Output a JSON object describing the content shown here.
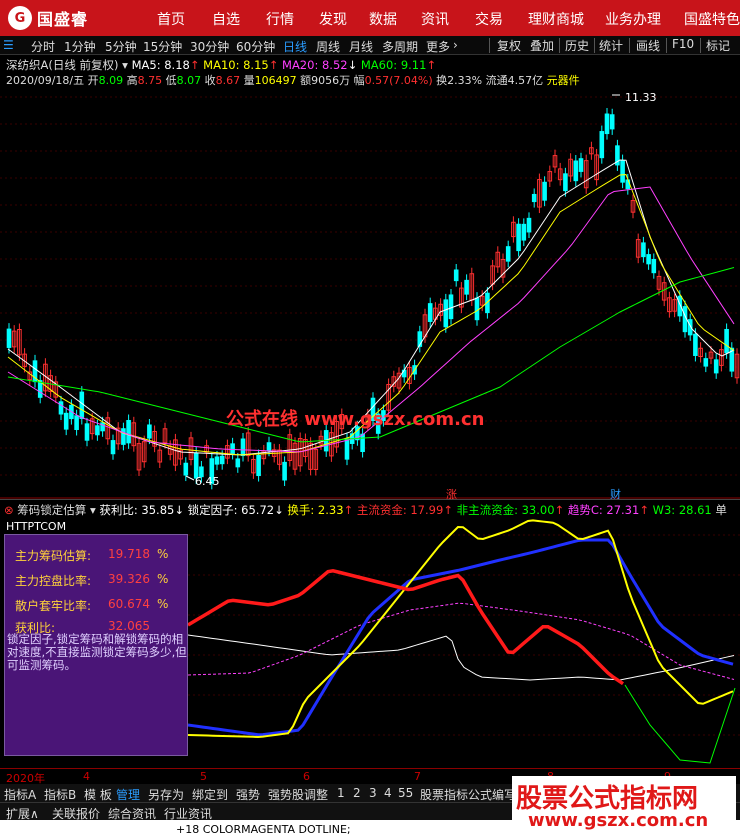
{
  "app": {
    "logo_text": "国盛睿",
    "nav": [
      "首页",
      "自选",
      "行情",
      "发现",
      "数据",
      "资讯",
      "交易",
      "理财商城",
      "业务办理",
      "国盛特色"
    ]
  },
  "periods": {
    "items": [
      "分时",
      "1分钟",
      "5分钟",
      "15分钟",
      "30分钟",
      "60分钟",
      "日线",
      "周线",
      "月线",
      "多周期",
      "更多"
    ],
    "active": "日线",
    "more_arrow": "›",
    "right_buttons": [
      "复权",
      "叠加",
      "历史",
      "统计",
      "画线",
      "F10",
      "标记"
    ]
  },
  "stock": {
    "name": "深纺织A",
    "mode": "(日线 前复权)",
    "ma": [
      {
        "label": "MA5: 8.18",
        "color": "#ffffff"
      },
      {
        "label": "MA10: 8.15",
        "color": "#ffff00"
      },
      {
        "label": "MA20: 8.52",
        "color": "#ff40ff"
      },
      {
        "label": "MA60: 9.11",
        "color": "#00ff00"
      }
    ],
    "ma_arrows": [
      "↑",
      "↑",
      "↓",
      "↑"
    ],
    "date": "2020/09/18/五",
    "open_label": "开",
    "open": "8.09",
    "high_label": "高",
    "high": "8.75",
    "low_label": "低",
    "low": "8.07",
    "close_label": "收",
    "close": "8.67",
    "vol_label": "量",
    "vol": "106497",
    "amt_label": "额",
    "amt": "9056万",
    "chg_label": "幅",
    "chg": "0.57(7.04%)",
    "turn_label": "换",
    "turn": "2.33%",
    "float_label": "流通",
    "float": "4.57亿",
    "sector": "元器件"
  },
  "main_chart_labels": {
    "high_mark": "11.33",
    "low_mark": "6.45",
    "watermark": "公式在线 www.gszx.com.cn"
  },
  "indicator": {
    "name": "筹码锁定估算",
    "arrow": "▾",
    "items": [
      {
        "label": "获利比: 35.85",
        "color": "#ffffff"
      },
      {
        "label": "锁定因子: 65.72",
        "color": "#ffffff"
      },
      {
        "label": "换手: 2.33",
        "color": "#ffff00"
      },
      {
        "label": "主流资金: 17.99",
        "color": "#ff3030"
      },
      {
        "label": "非主流资金: 33.00",
        "color": "#00ff00"
      },
      {
        "label": "趋势C: 27.31",
        "color": "#ff40ff"
      },
      {
        "label": "W3: 28.61",
        "color": "#00ff00"
      }
    ],
    "arrows": [
      "↓",
      "↑",
      "↑",
      "↑",
      "↑"
    ],
    "trailing": "单",
    "watermark": "HTTPTCOM",
    "event_labels": [
      "涨",
      "财"
    ]
  },
  "panel": {
    "rows": [
      {
        "label": "主力筹码估算:",
        "value": "19.718",
        "unit": "%"
      },
      {
        "label": "主力控盘比率:",
        "value": "39.326",
        "unit": "%"
      },
      {
        "label": "散户套牢比率:",
        "value": "60.674",
        "unit": "%"
      },
      {
        "label": "获利比:",
        "value": "32.065",
        "unit": ""
      }
    ],
    "desc": "锁定因子,锁定筹码和解锁筹码的相对速度,不直接监测锁定筹码多少,但可监测筹码。"
  },
  "date_axis": [
    "2020年",
    "4",
    "5",
    "6",
    "7",
    "8",
    "9"
  ],
  "tabs1": [
    "指标A",
    "指标B",
    "模 板",
    "管理",
    "另存为",
    "绑定到",
    "强势",
    "强势股调整",
    "1",
    "2",
    "3",
    "4",
    "55",
    "股票指标公式编写"
  ],
  "tabs1_active": "管理",
  "tabs2": [
    "扩展∧",
    "关联报价",
    "综合资讯",
    "行业资讯"
  ],
  "bottom_text": "+18 COLORMAGENTA DOTLINE;",
  "watermark2": {
    "line1": "股票公式指标网",
    "line2": "www.gszx.com.cn"
  }
}
